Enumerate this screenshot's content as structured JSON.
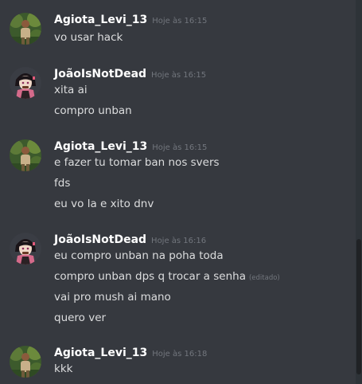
{
  "messages": [
    {
      "author": "Agiota_Levi_13",
      "timestamp": "Hoje às 16:15",
      "avatar_icon": "jungle-tourist-avatar",
      "lines": [
        {
          "text": "vo usar hack"
        }
      ]
    },
    {
      "author": "JoãoIsNotDead",
      "timestamp": "Hoje às 16:15",
      "avatar_icon": "anime-demon-slayer-avatar",
      "lines": [
        {
          "text": "xita ai"
        },
        {
          "text": "compro unban"
        }
      ]
    },
    {
      "author": "Agiota_Levi_13",
      "timestamp": "Hoje às 16:15",
      "avatar_icon": "jungle-tourist-avatar",
      "lines": [
        {
          "text": "e fazer tu tomar ban nos svers"
        },
        {
          "text": "fds"
        },
        {
          "text": "eu vo la e xito dnv"
        }
      ]
    },
    {
      "author": "JoãoIsNotDead",
      "timestamp": "Hoje às 16:16",
      "avatar_icon": "anime-demon-slayer-avatar",
      "lines": [
        {
          "text": "eu compro unban na poha toda"
        },
        {
          "text": "compro unban dps q trocar a senha",
          "edited": "(editado)"
        },
        {
          "text": "vai pro mush ai mano"
        },
        {
          "text": "quero ver"
        }
      ]
    },
    {
      "author": "Agiota_Levi_13",
      "timestamp": "Hoje às 16:18",
      "avatar_icon": "jungle-tourist-avatar",
      "lines": [
        {
          "text": "kkk"
        }
      ]
    }
  ],
  "colors": {
    "background": "#36393f",
    "username": "#ffffff",
    "message_text": "#dcddde",
    "timestamp": "#72767d",
    "scrollbar_track": "#2e3338",
    "scrollbar_thumb": "#202225"
  }
}
